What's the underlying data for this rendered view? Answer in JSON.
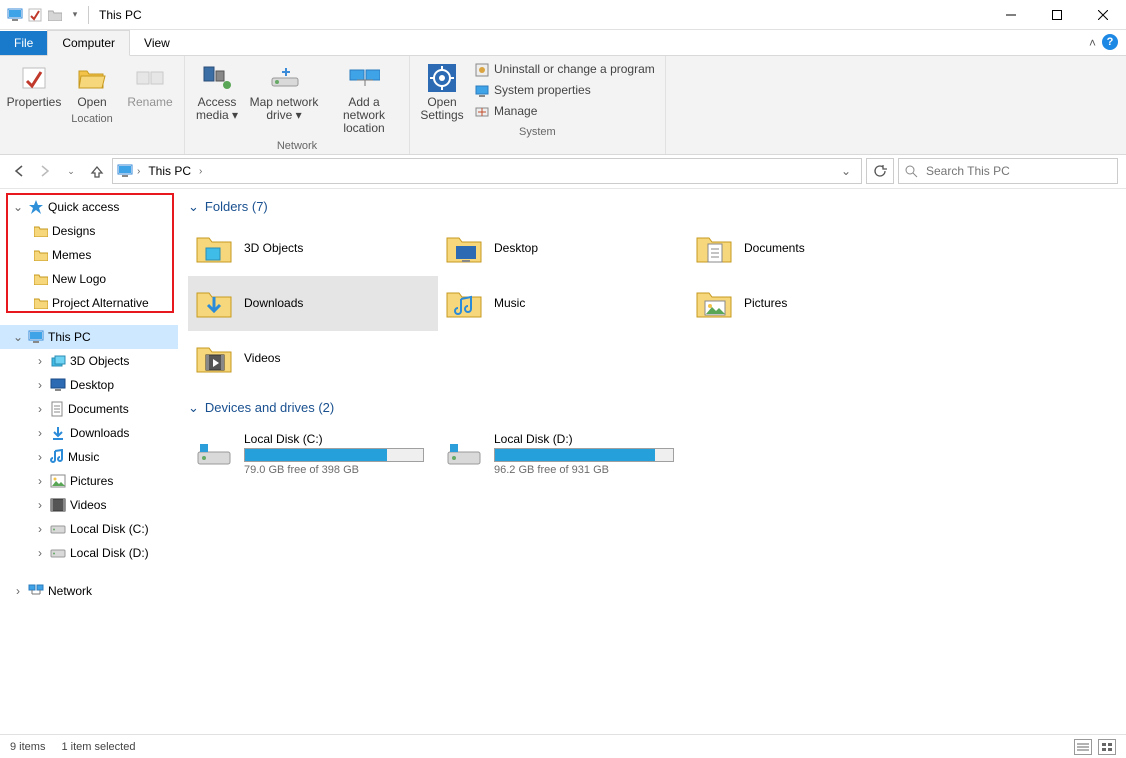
{
  "title": "This PC",
  "tabs": {
    "file": "File",
    "computer": "Computer",
    "view": "View"
  },
  "ribbon": {
    "location": {
      "label": "Location",
      "properties": "Properties",
      "open": "Open",
      "rename": "Rename"
    },
    "network": {
      "label": "Network",
      "access": "Access media ▾",
      "map": "Map network drive ▾",
      "add": "Add a network location"
    },
    "system": {
      "label": "System",
      "open": "Open Settings",
      "uninstall": "Uninstall or change a program",
      "sysprop": "System properties",
      "manage": "Manage"
    }
  },
  "breadcrumb": {
    "root": "This PC"
  },
  "search": {
    "placeholder": "Search This PC"
  },
  "navtree": {
    "quick": {
      "label": "Quick access",
      "items": [
        "Designs",
        "Memes",
        "New Logo",
        "Project Alternative"
      ]
    },
    "thispc": {
      "label": "This PC",
      "items": [
        "3D Objects",
        "Desktop",
        "Documents",
        "Downloads",
        "Music",
        "Pictures",
        "Videos",
        "Local Disk (C:)",
        "Local Disk (D:)"
      ]
    },
    "network": "Network"
  },
  "folders": {
    "header": "Folders (7)",
    "items": [
      "3D Objects",
      "Desktop",
      "Documents",
      "Downloads",
      "Music",
      "Pictures",
      "Videos"
    ],
    "selectedIndex": 3
  },
  "drives": {
    "header": "Devices and drives (2)",
    "items": [
      {
        "name": "Local Disk (C:)",
        "free": "79.0 GB free of 398 GB",
        "pct": 80
      },
      {
        "name": "Local Disk (D:)",
        "free": "96.2 GB free of 931 GB",
        "pct": 90
      }
    ]
  },
  "status": {
    "count": "9 items",
    "sel": "1 item selected"
  }
}
